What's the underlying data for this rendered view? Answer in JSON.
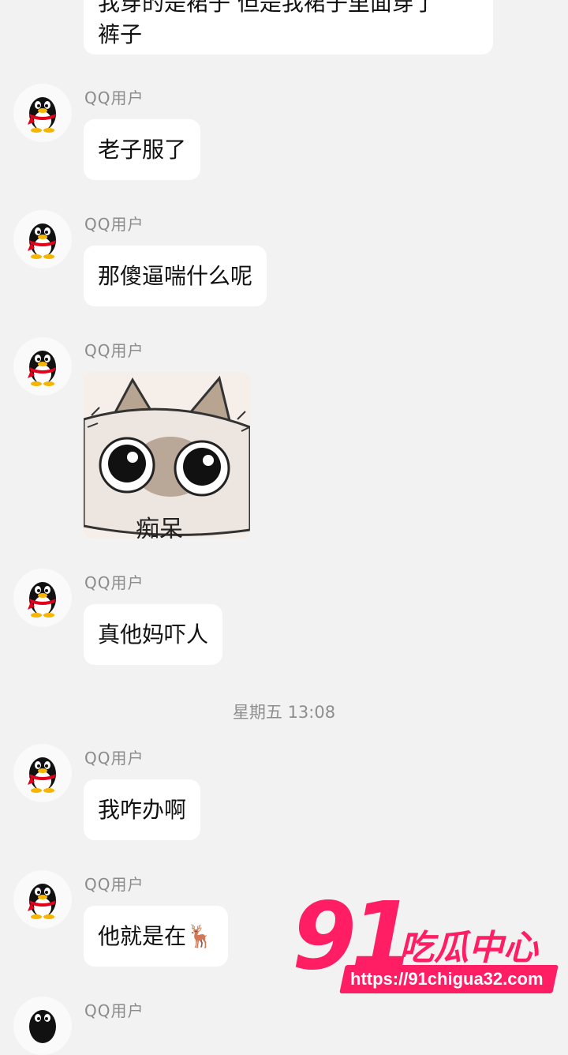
{
  "top_message": {
    "line1": "我穿的是裙子 但是我裙子里面穿了",
    "line2": "裤子"
  },
  "messages": [
    {
      "sender": "QQ用户",
      "text": "老子服了"
    },
    {
      "sender": "QQ用户",
      "text": "那傻逼喘什么呢"
    },
    {
      "sender": "QQ用户",
      "sticker_caption": "痴呆"
    },
    {
      "sender": "QQ用户",
      "text": "真他妈吓人"
    },
    {
      "sender": "QQ用户",
      "text": "我咋办啊"
    },
    {
      "sender": "QQ用户",
      "text": "他就是在🦌"
    },
    {
      "sender": "QQ用户"
    }
  ],
  "timestamp": "星期五 13:08",
  "watermark": {
    "number": "91",
    "name": "吃瓜中心",
    "url": "https://91chigua32.com"
  },
  "colors": {
    "background": "#f2f2f2",
    "bubble": "#ffffff",
    "watermark": "#ff1d63"
  }
}
